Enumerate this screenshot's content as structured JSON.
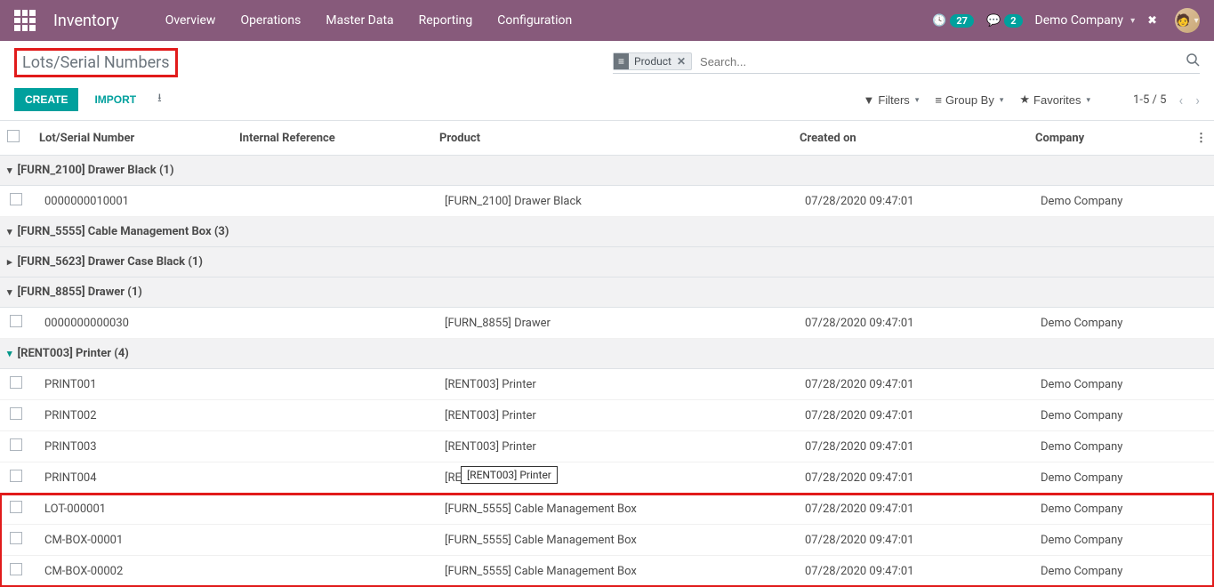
{
  "header": {
    "app_title": "Inventory",
    "nav": [
      "Overview",
      "Operations",
      "Master Data",
      "Reporting",
      "Configuration"
    ],
    "clock_badge": "27",
    "chat_badge": "2",
    "company": "Demo Company"
  },
  "control_panel": {
    "breadcrumb": "Lots/Serial Numbers",
    "create": "CREATE",
    "import": "IMPORT",
    "search_facet_category": "Product",
    "search_placeholder": "Search...",
    "filters": "Filters",
    "group_by": "Group By",
    "favorites": "Favorites",
    "pager": "1-5 / 5"
  },
  "columns": {
    "lot": "Lot/Serial Number",
    "ref": "Internal Reference",
    "product": "Product",
    "created": "Created on",
    "company": "Company"
  },
  "groups": [
    {
      "label": "[FURN_2100] Drawer Black (1)",
      "expanded": true,
      "teal": false,
      "red": false,
      "rows": [
        {
          "lot": "0000000010001",
          "product": "[FURN_2100] Drawer Black",
          "created": "07/28/2020 09:47:01",
          "company": "Demo Company"
        }
      ]
    },
    {
      "label": "[FURN_5555] Cable Management Box (3)",
      "expanded": true,
      "teal": false,
      "red": true,
      "rows": [
        {
          "lot": "LOT-000001",
          "product": "[FURN_5555] Cable Management Box",
          "created": "07/28/2020 09:47:01",
          "company": "Demo Company"
        },
        {
          "lot": "CM-BOX-00001",
          "product": "[FURN_5555] Cable Management Box",
          "created": "07/28/2020 09:47:01",
          "company": "Demo Company"
        },
        {
          "lot": "CM-BOX-00002",
          "product": "[FURN_5555] Cable Management Box",
          "created": "07/28/2020 09:47:01",
          "company": "Demo Company"
        }
      ]
    },
    {
      "label": "[FURN_5623] Drawer Case Black (1)",
      "expanded": false,
      "teal": false,
      "red": false,
      "rows": []
    },
    {
      "label": "[FURN_8855] Drawer (1)",
      "expanded": true,
      "teal": false,
      "red": false,
      "rows": [
        {
          "lot": "0000000000030",
          "product": "[FURN_8855] Drawer",
          "created": "07/28/2020 09:47:01",
          "company": "Demo Company"
        }
      ]
    },
    {
      "label": "[RENT003] Printer (4)",
      "expanded": true,
      "teal": true,
      "red": false,
      "rows": [
        {
          "lot": "PRINT001",
          "product": "[RENT003] Printer",
          "created": "07/28/2020 09:47:01",
          "company": "Demo Company"
        },
        {
          "lot": "PRINT002",
          "product": "[RENT003] Printer",
          "created": "07/28/2020 09:47:01",
          "company": "Demo Company"
        },
        {
          "lot": "PRINT003",
          "product": "[RENT003] Printer",
          "created": "07/28/2020 09:47:01",
          "company": "Demo Company"
        },
        {
          "lot": "PRINT004",
          "product": "[RENT003] Printer",
          "created": "07/28/2020 09:47:01",
          "company": "Demo Company"
        }
      ]
    }
  ],
  "tooltip": "[RENT003] Printer"
}
